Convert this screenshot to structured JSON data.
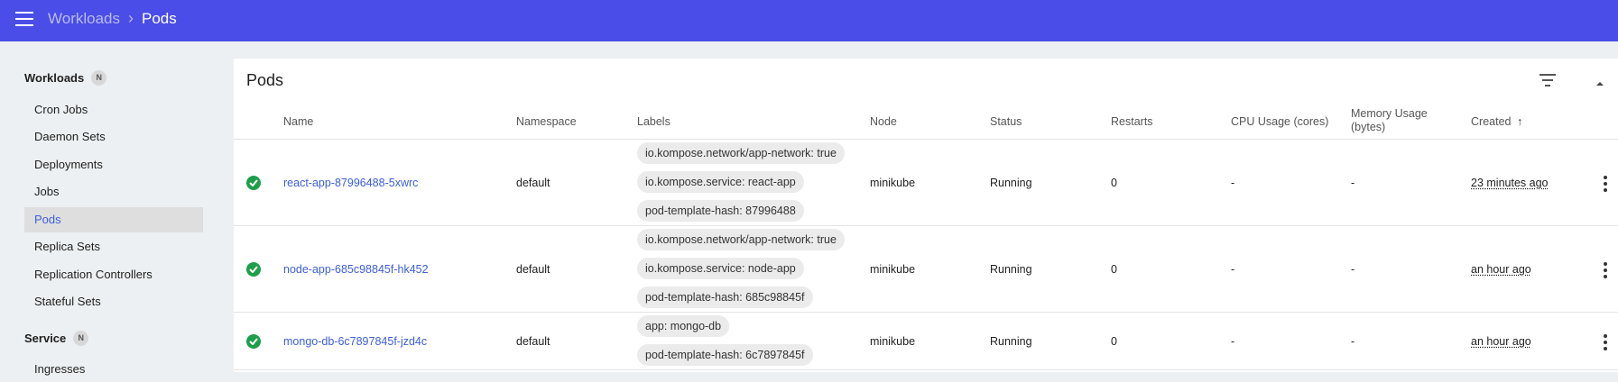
{
  "header": {
    "breadcrumb_parent": "Workloads",
    "breadcrumb_sep": "›",
    "breadcrumb_current": "Pods",
    "bar_color": "#4a4de7"
  },
  "sidebar": {
    "sections": [
      {
        "label": "Workloads",
        "badge": "N"
      },
      {
        "label": "Service",
        "badge": "N"
      }
    ],
    "items": [
      {
        "label": "Cron Jobs"
      },
      {
        "label": "Daemon Sets"
      },
      {
        "label": "Deployments"
      },
      {
        "label": "Jobs"
      },
      {
        "label": "Pods",
        "active": true
      },
      {
        "label": "Replica Sets"
      },
      {
        "label": "Replication Controllers"
      },
      {
        "label": "Stateful Sets"
      },
      {
        "label": "Ingresses"
      }
    ]
  },
  "main": {
    "title": "Pods",
    "columns": [
      "Name",
      "Namespace",
      "Labels",
      "Node",
      "Status",
      "Restarts",
      "CPU Usage (cores)",
      "Memory Usage (bytes)",
      "Created"
    ],
    "sort_indicator": "↑",
    "rows": [
      {
        "name": "react-app-87996488-5xwrc",
        "namespace": "default",
        "labels": [
          "io.kompose.network/app-network: true",
          "io.kompose.service: react-app",
          "pod-template-hash: 87996488"
        ],
        "node": "minikube",
        "status": "Running",
        "restarts": "0",
        "cpu": "-",
        "memory": "-",
        "created": "23 minutes ago"
      },
      {
        "name": "node-app-685c98845f-hk452",
        "namespace": "default",
        "labels": [
          "io.kompose.network/app-network: true",
          "io.kompose.service: node-app",
          "pod-template-hash: 685c98845f"
        ],
        "node": "minikube",
        "status": "Running",
        "restarts": "0",
        "cpu": "-",
        "memory": "-",
        "created": "an hour ago"
      },
      {
        "name": "mongo-db-6c7897845f-jzd4c",
        "namespace": "default",
        "labels": [
          "app: mongo-db",
          "pod-template-hash: 6c7897845f"
        ],
        "node": "minikube",
        "status": "Running",
        "restarts": "0",
        "cpu": "-",
        "memory": "-",
        "created": "an hour ago"
      }
    ]
  }
}
